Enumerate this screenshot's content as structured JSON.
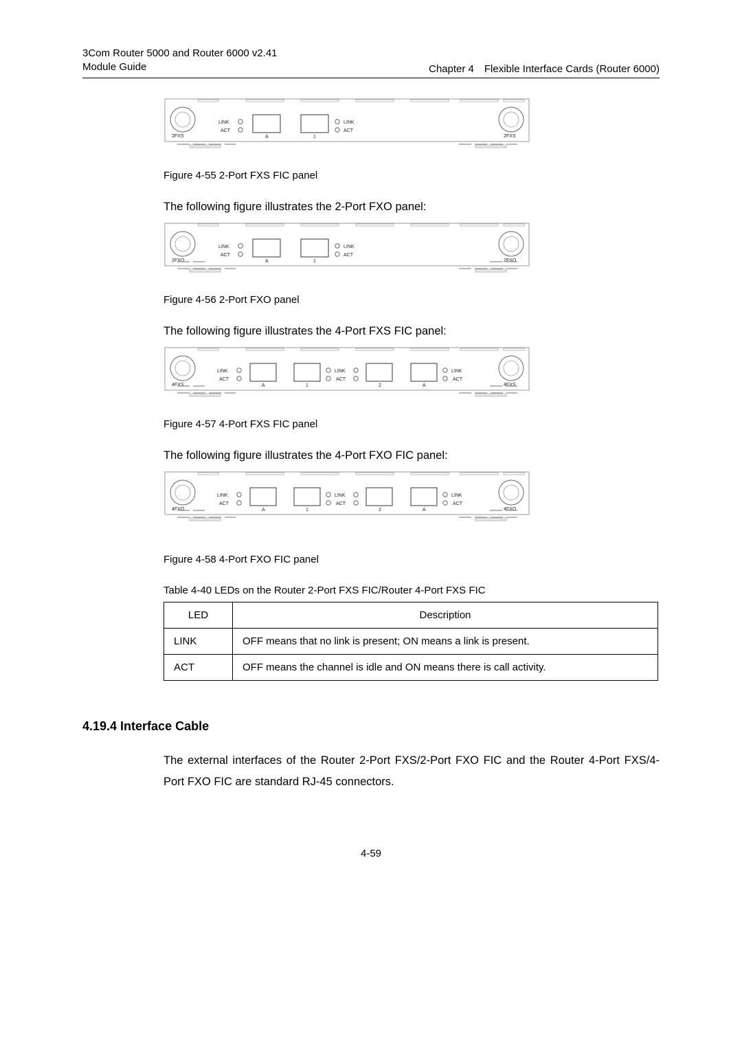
{
  "header": {
    "left_line1": "3Com Router 5000 and Router 6000 v2.41",
    "left_line2": "Module Guide",
    "right": "Chapter 4 Flexible Interface Cards (Router 6000)"
  },
  "panel_labels": {
    "link": "LINK",
    "act": "ACT",
    "model_2fxs": "2FXS",
    "model_2fxo": "2FXO",
    "model_4fxs": "4FXS",
    "model_4fxo": "4FXO",
    "a": "A",
    "num1": "1",
    "num2": "2"
  },
  "captions": {
    "fig55": "Figure 4-55 2-Port FXS FIC panel",
    "fig56": "Figure 4-56 2-Port FXO panel",
    "fig57": "Figure 4-57 4-Port FXS FIC panel",
    "fig58": "Figure 4-58 4-Port FXO FIC panel",
    "table40": "Table 4-40 LEDs on the Router 2-Port FXS FIC/Router 4-Port FXS FIC"
  },
  "body": {
    "para1": "The following figure illustrates the 2-Port FXO panel:",
    "para2": "The following figure illustrates the 4-Port FXS FIC panel:",
    "para3": "The following figure illustrates the 4-Port FXO FIC panel:"
  },
  "led_table": {
    "head_led": "LED",
    "head_desc": "Description",
    "rows": [
      {
        "led": "LINK",
        "desc": "OFF means that no link is present; ON means a link is present."
      },
      {
        "led": "ACT",
        "desc": "OFF means the channel is idle and ON means there is call activity."
      }
    ]
  },
  "section419_4": {
    "heading": "4.19.4  Interface Cable",
    "para": "The external interfaces of the Router 2-Port FXS/2-Port FXO FIC and the Router 4-Port FXS/4-Port FXO FIC are standard RJ-45 connectors."
  },
  "footer": {
    "page": "4-59"
  }
}
